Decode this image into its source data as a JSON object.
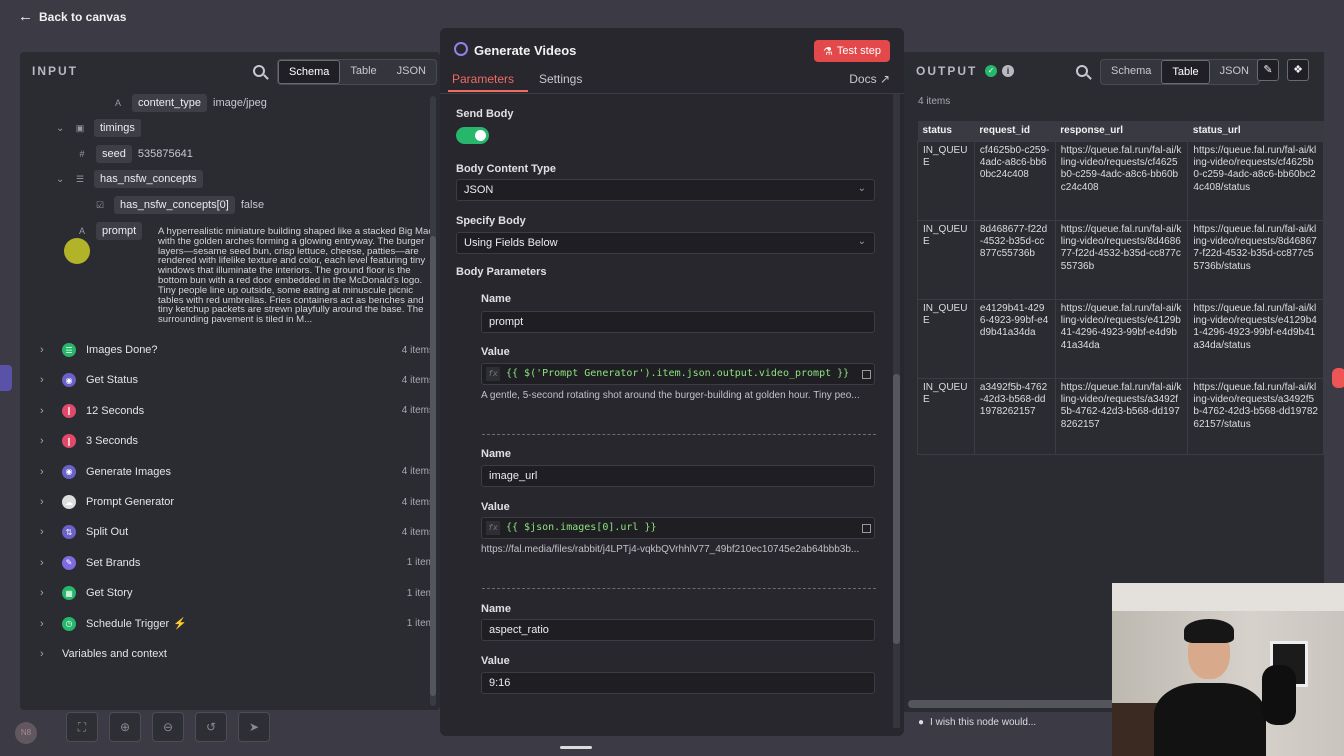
{
  "topbar": {
    "back_label": "Back to canvas"
  },
  "input": {
    "title": "INPUT",
    "tabs": [
      "Schema",
      "Table",
      "JSON"
    ],
    "fields": {
      "content_type": {
        "key": "content_type",
        "value": "image/jpeg"
      },
      "timings": {
        "key": "timings"
      },
      "seed": {
        "key": "seed",
        "value": "535875641"
      },
      "has_nsfw_concepts": {
        "key": "has_nsfw_concepts"
      },
      "has_nsfw_concepts_0": {
        "key": "has_nsfw_concepts[0]",
        "value": "false"
      },
      "prompt": {
        "key": "prompt",
        "value": "A hyperrealistic miniature building shaped like a stacked Big Mac, with the golden arches forming a glowing entryway. The burger layers—sesame seed bun, crisp lettuce, cheese, patties—are rendered with lifelike texture and color, each level featuring tiny windows that illuminate the interiors. The ground floor is the bottom bun with a red door embedded in the McDonald's logo. Tiny people line up outside, some eating at minuscule picnic tables with red umbrellas. Fries containers act as benches and tiny ketchup packets are strewn playfully around the base. The surrounding pavement is tiled in M..."
      }
    },
    "nodes": [
      {
        "label": "Images Done?",
        "count": "4 items",
        "color": "#26b76b",
        "icon": "list-icon"
      },
      {
        "label": "Get Status",
        "count": "4 items",
        "color": "#6a62c8",
        "icon": "globe-icon"
      },
      {
        "label": "12 Seconds",
        "count": "4 items",
        "color": "#e04a68",
        "icon": "pause-icon"
      },
      {
        "label": "3 Seconds",
        "count": "",
        "color": "#e04a68",
        "icon": "pause-icon"
      },
      {
        "label": "Generate Images",
        "count": "4 items",
        "color": "#6a62c8",
        "icon": "globe-icon"
      },
      {
        "label": "Prompt Generator",
        "count": "4 items",
        "color": "#dddddd",
        "icon": "cloud-icon"
      },
      {
        "label": "Split Out",
        "count": "4 items",
        "color": "#6a62c8",
        "icon": "split-icon"
      },
      {
        "label": "Set Brands",
        "count": "1 item",
        "color": "#7f6ae0",
        "icon": "pen-icon"
      },
      {
        "label": "Get Story",
        "count": "1 item",
        "color": "#26b76b",
        "icon": "sheet-icon"
      },
      {
        "label": "Schedule Trigger",
        "count": "1 item",
        "color": "#26b76b",
        "icon": "clock-icon"
      }
    ],
    "variables_label": "Variables and context"
  },
  "modal": {
    "title": "Generate Videos",
    "test_label": "Test step",
    "tabs": [
      "Parameters",
      "Settings"
    ],
    "docs_label": "Docs",
    "send_body_label": "Send Body",
    "body_content_type_label": "Body Content Type",
    "body_content_type_value": "JSON",
    "specify_body_label": "Specify Body",
    "specify_body_value": "Using Fields Below",
    "body_params_label": "Body Parameters",
    "name_label": "Name",
    "value_label": "Value",
    "params": [
      {
        "name": "prompt",
        "value": "{{ $('Prompt Generator').item.json.output.video_prompt }}",
        "preview": "A gentle, 5-second rotating shot around the burger-building at golden hour. Tiny peo..."
      },
      {
        "name": "image_url",
        "value": "{{ $json.images[0].url }}",
        "preview": "https://fal.media/files/rabbit/j4LPTj4-vqkbQVrhhlV77_49bf210ec10745e2ab64bbb3b..."
      },
      {
        "name": "aspect_ratio",
        "value": "9:16"
      }
    ]
  },
  "output": {
    "title": "OUTPUT",
    "tabs": [
      "Schema",
      "Table",
      "JSON"
    ],
    "items_count": "4 items",
    "columns": [
      "status",
      "request_id",
      "response_url",
      "status_url"
    ],
    "rows": [
      [
        "IN_QUEUE",
        "cf4625b0-c259-4adc-a8c6-bb60bc24c408",
        "https://queue.fal.run/fal-ai/kling-video/requests/cf4625b0-c259-4adc-a8c6-bb60bc24c408",
        "https://queue.fal.run/fal-ai/kling-video/requests/cf4625b0-c259-4adc-a8c6-bb60bc24c408/status"
      ],
      [
        "IN_QUEUE",
        "8d468677-f22d-4532-b35d-cc877c55736b",
        "https://queue.fal.run/fal-ai/kling-video/requests/8d468677-f22d-4532-b35d-cc877c55736b",
        "https://queue.fal.run/fal-ai/kling-video/requests/8d468677-f22d-4532-b35d-cc877c55736b/status"
      ],
      [
        "IN_QUEUE",
        "e4129b41-4296-4923-99bf-e4d9b41a34da",
        "https://queue.fal.run/fal-ai/kling-video/requests/e4129b41-4296-4923-99bf-e4d9b41a34da",
        "https://queue.fal.run/fal-ai/kling-video/requests/e4129b41-4296-4923-99bf-e4d9b41a34da/status"
      ],
      [
        "IN_QUEUE",
        "a3492f5b-4762-42d3-b568-dd1978262157",
        "https://queue.fal.run/fal-ai/kling-video/requests/a3492f5b-4762-42d3-b568-dd1978262157",
        "https://queue.fal.run/fal-ai/kling-video/requests/a3492f5b-4762-42d3-b568-dd1978262157/status"
      ]
    ],
    "wish_label": "I wish this node would..."
  },
  "colors": {
    "accent": "#ef6b63",
    "test_button": "#e3484a",
    "toggle_on": "#26b76b",
    "expression": "#8ee37f"
  }
}
